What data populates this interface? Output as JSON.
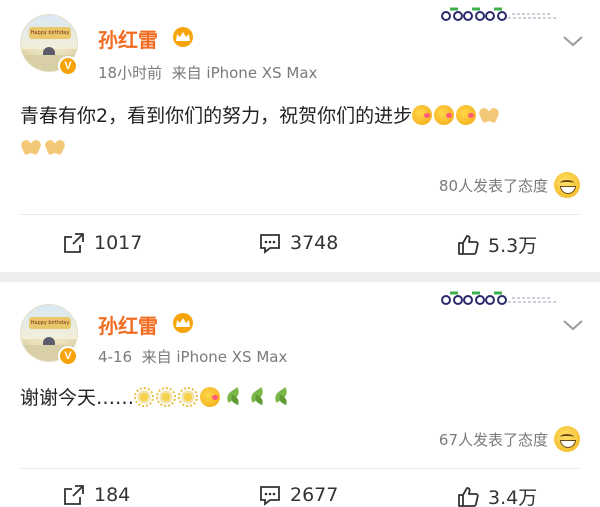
{
  "posts": [
    {
      "author": "孙红雷",
      "avatar_banner": "Happy birthday",
      "verified_badge": "V",
      "time": "18小时前",
      "source": "来自 iPhone XS Max",
      "text": "青春有你2，看到你们的努力，祝贺你们的进步",
      "emojis": [
        "hug",
        "hug",
        "hug",
        "clap",
        "clap",
        "clap"
      ],
      "reactions": "80人发表了态度",
      "repost_count": "1017",
      "comment_count": "3748",
      "like_count": "5.3万"
    },
    {
      "author": "孙红雷",
      "avatar_banner": "Happy birthday",
      "verified_badge": "V",
      "time": "4-16",
      "source": "来自 iPhone XS Max",
      "text": "谢谢今天……",
      "emojis": [
        "flower",
        "flower",
        "flower",
        "hug",
        "leaf",
        "leaf",
        "leaf"
      ],
      "reactions": "67人发表了态度",
      "repost_count": "184",
      "comment_count": "2677",
      "like_count": "3.4万"
    }
  ],
  "colors": {
    "author": "#f26d22",
    "meta": "#7a7a7a",
    "vip": "#f7a30a"
  },
  "icons": [
    "crown-icon",
    "chevron-down-icon",
    "repost-icon",
    "comment-icon",
    "like-icon",
    "smile-icon",
    "bicycle-decoration-icon"
  ]
}
